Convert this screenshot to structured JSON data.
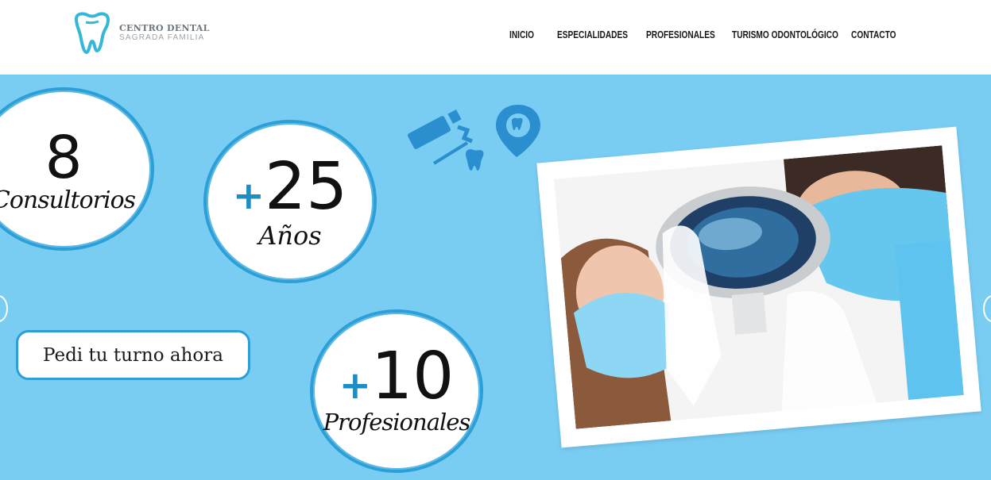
{
  "brand": {
    "line1": "CENTRO DENTAL",
    "line2": "SAGRADA FAMILIA",
    "logo_color": "#35b7d8"
  },
  "nav": {
    "items": [
      "INICIO",
      "ESPECIALIDADES",
      "PROFESIONALES",
      "TURISMO ODONTOLÓGICO",
      "CONTACTO"
    ]
  },
  "hero": {
    "background": "#79cdf3",
    "stats": [
      {
        "plus": "",
        "number": "8",
        "label": "Consultorios"
      },
      {
        "plus": "+",
        "number": "25",
        "label": "Años"
      },
      {
        "plus": "+",
        "number": "10",
        "label": "Profesionales"
      }
    ],
    "cta_label": "Pedi tu turno ahora",
    "icons": [
      "toothpaste-icon",
      "tooth-icon",
      "tooth-location-pin-icon"
    ],
    "photo_alt_icon": "dentists-photo"
  },
  "slider": {
    "prev_icon": "chevron-left-icon",
    "next_icon": "chevron-right-icon"
  }
}
